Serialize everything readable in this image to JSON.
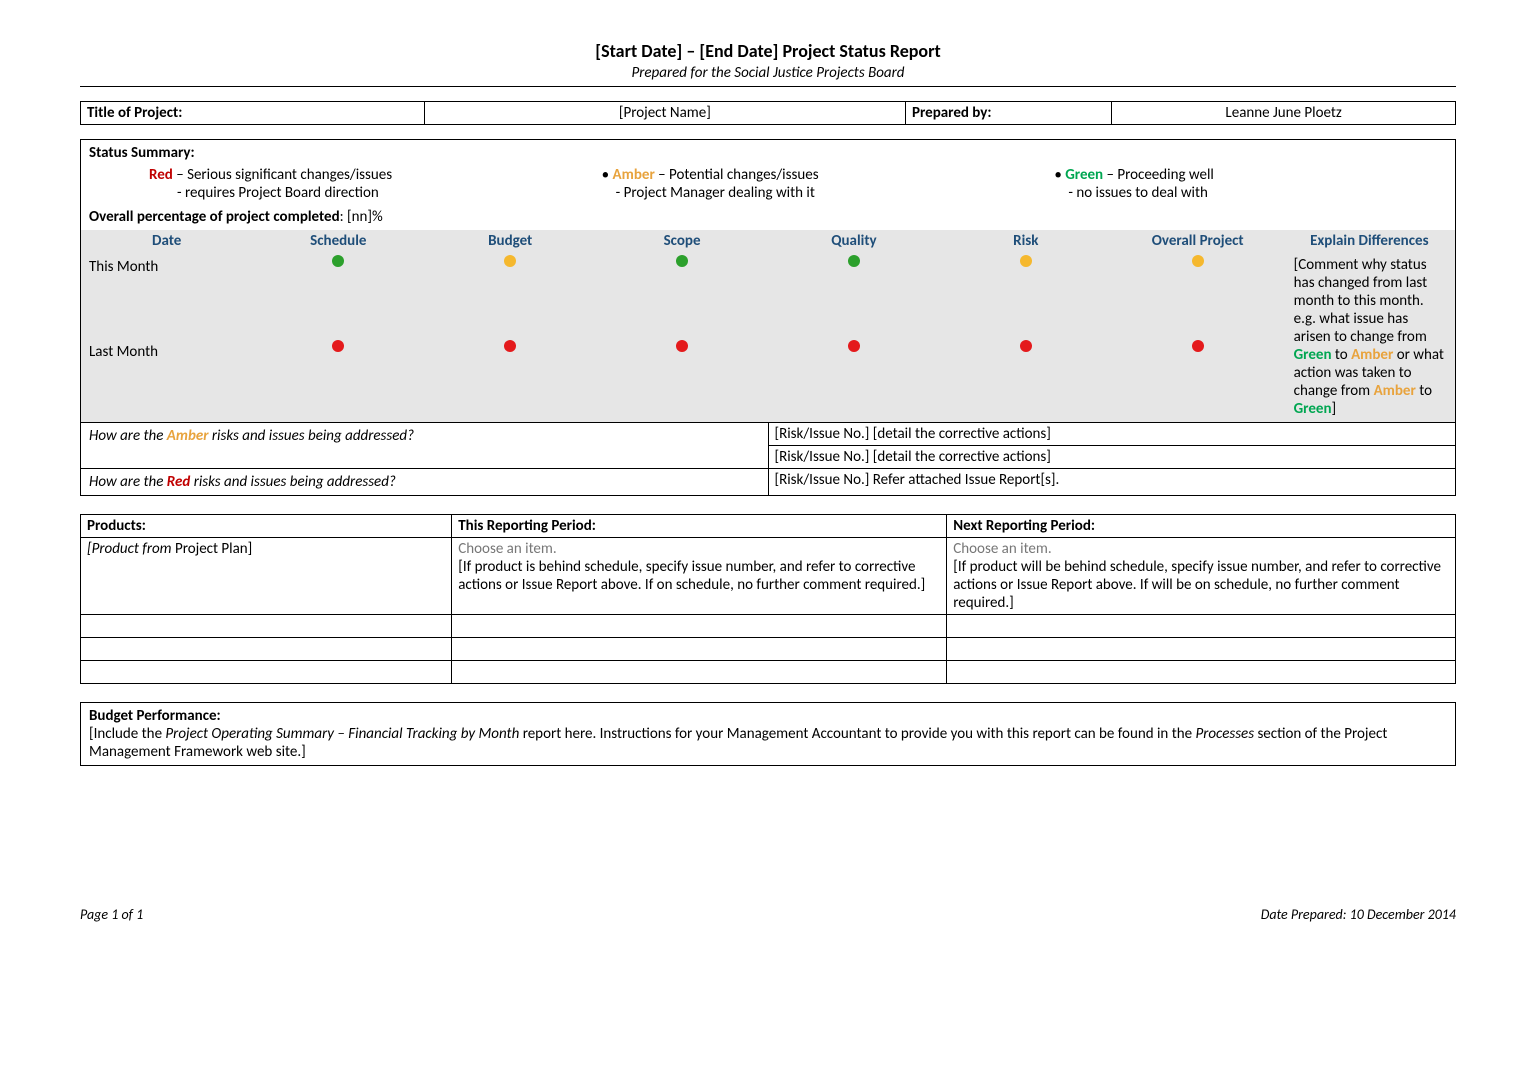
{
  "header": {
    "title": "[Start Date] – [End Date] Project Status Report",
    "subtitle": "Prepared for the Social Justice Projects Board"
  },
  "info": {
    "title_label": "Title of Project:",
    "project_name": "[Project Name]",
    "prepared_label": "Prepared by:",
    "prepared_by": "Leanne June Ploetz"
  },
  "status_summary": {
    "heading": "Status Summary:",
    "legend": {
      "red": {
        "name": "Red",
        "desc": " – Serious significant changes/issues",
        "sub": "- requires Project Board direction"
      },
      "amber": {
        "name": "Amber",
        "desc": " – Potential changes/issues",
        "sub": "- Project Manager dealing with it"
      },
      "green": {
        "name": "Green",
        "desc": " – Proceeding well",
        "sub": "- no issues to deal with"
      }
    },
    "pct_label": "Overall percentage of project completed",
    "pct_value": ":  [nn]%",
    "cols": {
      "date": "Date",
      "schedule": "Schedule",
      "budget": "Budget",
      "scope": "Scope",
      "quality": "Quality",
      "risk": "Risk",
      "overall": "Overall Project",
      "explain": "Explain Differences"
    },
    "row_this": "This Month",
    "row_last": "Last Month",
    "explain_text": {
      "p1a": "[Comment why status has changed from last month to this month.  e.g. what issue has arisen to change from ",
      "g1": "Green",
      "p1b": " to ",
      "a1": "Amber",
      "p1c": " or what action was taken to change from ",
      "a2": "Amber",
      "p1d": " to ",
      "g2": "Green",
      "p1e": "]"
    },
    "amber_q_a": "How are the ",
    "amber_q_b": "Amber",
    "amber_q_c": " risks and issues being addressed?",
    "amber_a1": "[Risk/Issue No.]  [detail the corrective actions]",
    "amber_a2": "[Risk/Issue No.]  [detail the corrective actions]",
    "red_q_a": "How are the ",
    "red_q_b": "Red",
    "red_q_c": " risks and issues being addressed?",
    "red_a": "[Risk/Issue No.]  Refer attached Issue Report[s]."
  },
  "products": {
    "col1": "Products:",
    "col2": "This Reporting Period:",
    "col3": "Next Reporting Period:",
    "row1_c1_ital": "[Product from ",
    "row1_c1_rest": "Project Plan]",
    "choose": "Choose an item.",
    "row1_c2": "[If product is behind schedule, specify issue number, and refer to corrective actions or Issue Report above.  If on schedule, no further comment required.]",
    "row1_c3": "[If product will be behind schedule, specify issue number, and refer to corrective actions or Issue Report above.  If will be on schedule, no further comment required.]"
  },
  "budget": {
    "heading": "Budget Performance:",
    "t1": "[Include the ",
    "ital": "Project Operating Summary – Financial Tracking by Month",
    "t2": " report here.  Instructions for your Management Accountant to provide you with this report can be found in the ",
    "ital2": "Processes",
    "t3": " section of the Project Management Framework web site.]"
  },
  "footer": {
    "left": "Page 1 of 1",
    "right": "Date Prepared:  10 December 2014"
  }
}
